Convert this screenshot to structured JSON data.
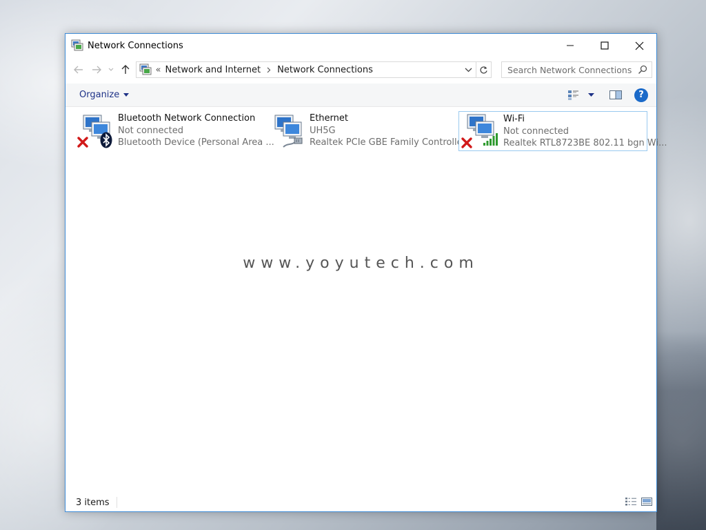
{
  "window": {
    "title": "Network Connections"
  },
  "address": {
    "overflow": "«",
    "crumbs": [
      "Network and Internet",
      "Network Connections"
    ]
  },
  "search": {
    "placeholder": "Search Network Connections"
  },
  "toolbar": {
    "organize_label": "Organize"
  },
  "connections": [
    {
      "name": "Bluetooth Network Connection",
      "status": "Not connected",
      "device": "Bluetooth Device (Personal Area ...",
      "badge": "bluetooth-icon",
      "error": true,
      "selected": false
    },
    {
      "name": "Ethernet",
      "status": "UH5G",
      "device": "Realtek PCIe GBE Family Controller",
      "badge": "ethernet-cable-icon",
      "error": false,
      "selected": false
    },
    {
      "name": "Wi-Fi",
      "status": "Not connected",
      "device": "Realtek RTL8723BE 802.11 bgn Wi...",
      "badge": "wifi-signal-icon",
      "error": true,
      "selected": true
    }
  ],
  "watermark": "www.yoyutech.com",
  "statusbar": {
    "count": "3 items"
  },
  "colors": {
    "accent": "#3c8ad6",
    "link": "#1e3287",
    "help": "#1b6ac9",
    "error_x": "#d11919",
    "wifi_green": "#2e9a2e"
  }
}
